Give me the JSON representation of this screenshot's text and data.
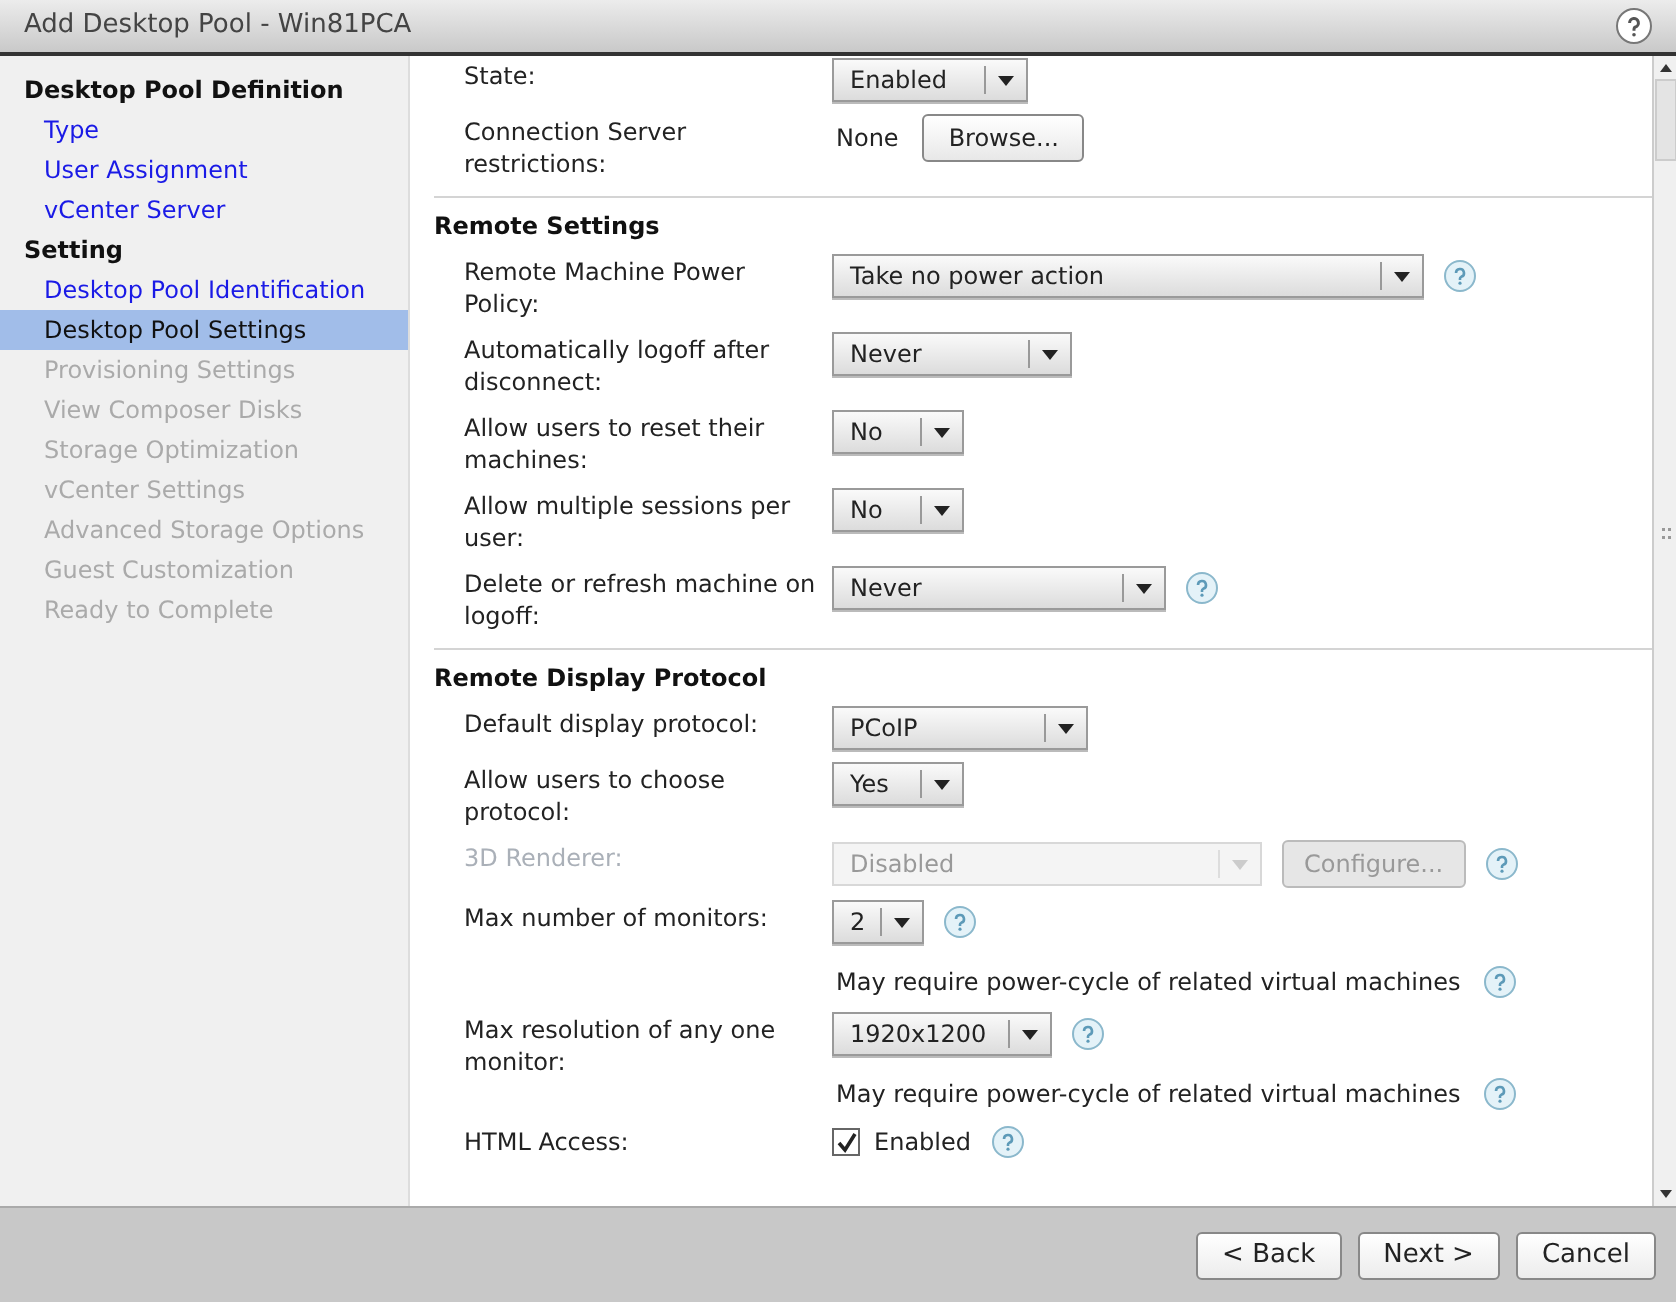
{
  "window": {
    "title": "Add Desktop Pool - Win81PCA"
  },
  "sidebar": {
    "groups": [
      {
        "title": "Desktop Pool Definition",
        "items": [
          {
            "label": "Type",
            "selected": false,
            "disabled": false
          },
          {
            "label": "User Assignment",
            "selected": false,
            "disabled": false
          },
          {
            "label": "vCenter Server",
            "selected": false,
            "disabled": false
          }
        ]
      },
      {
        "title": "Setting",
        "items": [
          {
            "label": "Desktop Pool Identification",
            "selected": false,
            "disabled": false
          },
          {
            "label": "Desktop Pool Settings",
            "selected": true,
            "disabled": false
          },
          {
            "label": "Provisioning Settings",
            "selected": false,
            "disabled": true
          },
          {
            "label": "View Composer Disks",
            "selected": false,
            "disabled": true
          },
          {
            "label": "Storage Optimization",
            "selected": false,
            "disabled": true
          },
          {
            "label": "vCenter Settings",
            "selected": false,
            "disabled": true
          },
          {
            "label": "Advanced Storage Options",
            "selected": false,
            "disabled": true
          },
          {
            "label": "Guest Customization",
            "selected": false,
            "disabled": true
          },
          {
            "label": "Ready to Complete",
            "selected": false,
            "disabled": true
          }
        ]
      }
    ]
  },
  "sections": [
    {
      "rows": [
        {
          "kind": "select",
          "label": "State:",
          "value": "Enabled"
        },
        {
          "kind": "text_button",
          "label": "Connection Server restrictions:",
          "value": "None",
          "button": "Browse..."
        }
      ]
    },
    {
      "title": "Remote Settings",
      "rows": [
        {
          "kind": "select",
          "label": "Remote Machine Power Policy:",
          "value": "Take no power action",
          "help": true
        },
        {
          "kind": "select",
          "label": "Automatically logoff after disconnect:",
          "value": "Never"
        },
        {
          "kind": "select",
          "label": "Allow users to reset their machines:",
          "value": "No"
        },
        {
          "kind": "select",
          "label": "Allow multiple sessions per user:",
          "value": "No"
        },
        {
          "kind": "select",
          "label": "Delete or refresh machine on logoff:",
          "value": "Never",
          "help": true
        }
      ]
    },
    {
      "title": "Remote Display Protocol",
      "rows": [
        {
          "kind": "select",
          "label": "Default display protocol:",
          "value": "PCoIP"
        },
        {
          "kind": "select",
          "label": "Allow users to choose protocol:",
          "value": "Yes"
        },
        {
          "kind": "select",
          "label": "3D Renderer:",
          "value": "Disabled",
          "disabled": true,
          "help": true,
          "button": "Configure..."
        },
        {
          "kind": "select",
          "label": "Max number of monitors:",
          "value": "2",
          "help": true,
          "note": "May require power-cycle of related virtual machines"
        },
        {
          "kind": "select",
          "label": "Max resolution of any one monitor:",
          "value": "1920x1200",
          "help": true,
          "note": "May require power-cycle of related virtual machines"
        },
        {
          "kind": "checkbox",
          "label": "HTML Access:",
          "value": "Enabled",
          "checked": true,
          "help": true
        }
      ]
    }
  ],
  "footer": {
    "buttons": [
      "< Back",
      "Next >",
      "Cancel"
    ]
  }
}
